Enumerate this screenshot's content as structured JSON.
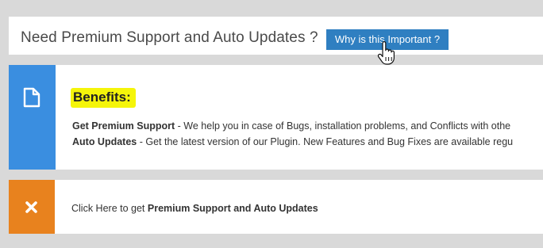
{
  "header": {
    "title": "Need Premium Support and Auto Updates ?",
    "button_label": "Why is this Important ?"
  },
  "benefits": {
    "heading": "Benefits:",
    "items": [
      {
        "label": "Get Premium Support",
        "text": " - We help you in case of Bugs, installation problems, and Conflicts with othe"
      },
      {
        "label": "Auto Updates",
        "text": " - Get the latest version of our Plugin. New Features and Bug Fixes are available regu"
      }
    ]
  },
  "dismiss": {
    "prefix": "Click Here to get ",
    "bold": "Premium Support and Auto Updates"
  },
  "colors": {
    "button": "#2f7fc1",
    "benefits_side": "#3a8ee0",
    "dismiss_side": "#e8821e",
    "highlight": "#f5f50a",
    "background": "#d9d9d9"
  },
  "icons": {
    "benefits": "document-icon",
    "dismiss": "close-icon",
    "cursor": "hand-pointer-cursor"
  }
}
